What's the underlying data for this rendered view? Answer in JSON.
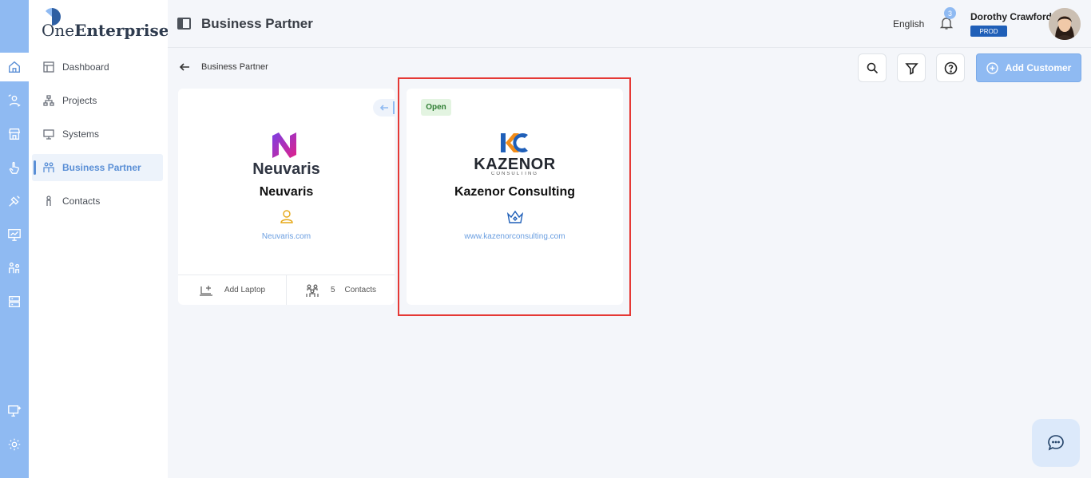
{
  "app": {
    "logo_prefix": "One",
    "logo_suffix": "Enterprise"
  },
  "header": {
    "title": "Business Partner",
    "language": "English",
    "notification_count": "3",
    "user_name": "Dorothy Crawford",
    "environment": "PROD"
  },
  "sidebar": {
    "items": [
      {
        "label": "Dashboard",
        "icon": "dashboard-icon"
      },
      {
        "label": "Projects",
        "icon": "hierarchy-icon"
      },
      {
        "label": "Systems",
        "icon": "systems-icon"
      },
      {
        "label": "Business Partner",
        "icon": "people-icon",
        "active": true
      },
      {
        "label": "Contacts",
        "icon": "person-icon"
      }
    ]
  },
  "breadcrumb": {
    "label": "Business Partner"
  },
  "toolbar": {
    "add_label": "Add Customer"
  },
  "cards": [
    {
      "logo_text": "Neuvaris",
      "name": "Neuvaris",
      "link": "Neuvaris.com",
      "footer": {
        "add_label": "Add Laptop",
        "contacts_count": "5",
        "contacts_label": "Contacts"
      }
    },
    {
      "status": "Open",
      "logo_text": "KAZENOR",
      "logo_sub": "CONSULTING",
      "name": "Kazenor Consulting",
      "link": "www.kazenorconsulting.com"
    }
  ],
  "colors": {
    "accent": "#8fbaf2",
    "brand_blue": "#1f5fb8",
    "highlight": "#e53935"
  }
}
